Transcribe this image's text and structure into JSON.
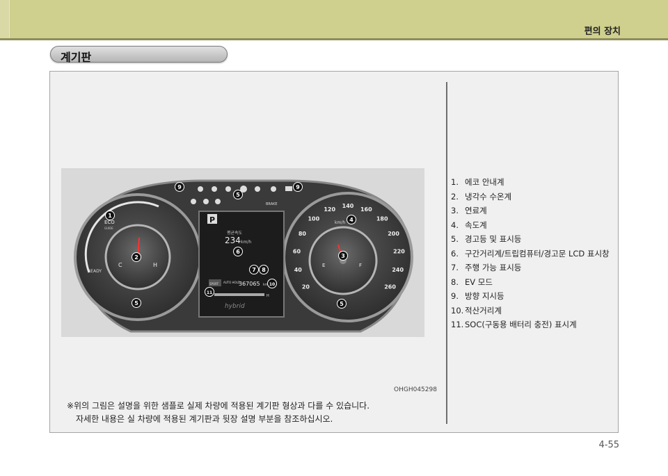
{
  "header": {
    "title": "편의 장치"
  },
  "section": {
    "title": "계기판"
  },
  "image_code": "OHGH045298",
  "note": {
    "line1": "※위의 그림은 설명을 위한 샘플로 실제 차량에 적용된 계기판 형상과 다를 수 있습니다.",
    "line2": "자세한 내용은 실 차량에 적용된 계기판과 뒷장 설명 부분을 참조하십시오."
  },
  "legend": [
    {
      "num": "1.",
      "text": "에코 안내계"
    },
    {
      "num": "2.",
      "text": "냉각수 수온계"
    },
    {
      "num": "3.",
      "text": "연료계"
    },
    {
      "num": "4.",
      "text": "속도계"
    },
    {
      "num": "5.",
      "text": "경고등 및 표시등"
    },
    {
      "num": "6.",
      "text": "구간거리계/트립컴퓨터/경고문 LCD 표시창"
    },
    {
      "num": "7.",
      "text": "주행 가능 표시등"
    },
    {
      "num": "8.",
      "text": "EV 모드"
    },
    {
      "num": "9.",
      "text": "방향 지시등"
    },
    {
      "num": "10.",
      "text": "적산거리계"
    },
    {
      "num": "11.",
      "text": "SOC(구동용 배터리 충전) 표시계"
    }
  ],
  "cluster": {
    "eco_label": "ECO",
    "eco_sub": "GUIDE",
    "ready_label": "READY",
    "temp_c": "C",
    "temp_h": "H",
    "fuel_e": "E",
    "fuel_f": "F",
    "speed_unit": "km/h",
    "speed_ticks": [
      "20",
      "40",
      "60",
      "80",
      "100",
      "120",
      "140",
      "160",
      "180",
      "200",
      "220",
      "240",
      "260"
    ],
    "gear": "P",
    "avg_speed_label": "평균속도",
    "avg_speed_value": "234",
    "avg_speed_unit": "km/h",
    "odometer": "367065",
    "odometer_unit": "km",
    "sport_label": "SPORT",
    "auto_hold_label": "AUTO HOLD",
    "soc_l": "L",
    "soc_h": "H",
    "brake_label": "BRAKE",
    "brand": "hybrid",
    "badges": [
      {
        "n": "1"
      },
      {
        "n": "2"
      },
      {
        "n": "3"
      },
      {
        "n": "4"
      },
      {
        "n": "5"
      },
      {
        "n": "5"
      },
      {
        "n": "5"
      },
      {
        "n": "6"
      },
      {
        "n": "7"
      },
      {
        "n": "8"
      },
      {
        "n": "9"
      },
      {
        "n": "9"
      },
      {
        "n": "10"
      },
      {
        "n": "11"
      }
    ]
  },
  "page_number": "4-55"
}
